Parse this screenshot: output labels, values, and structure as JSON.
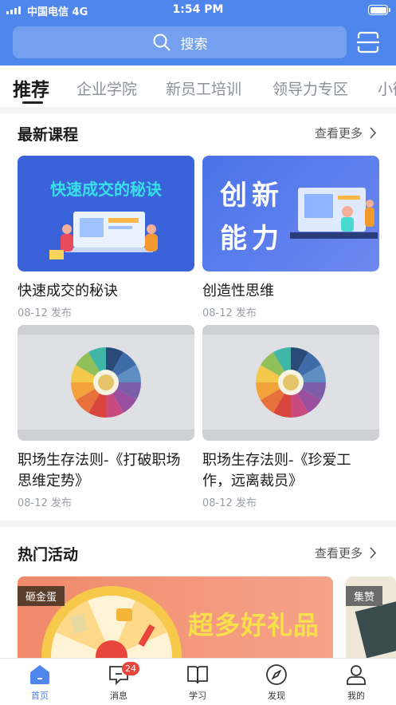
{
  "status_bar": {
    "carrier": "中国电信  4G",
    "time": "1:54 PM"
  },
  "search": {
    "placeholder": "搜索"
  },
  "tabs": [
    {
      "label": "推荐"
    },
    {
      "label": "企业学院"
    },
    {
      "label": "新员工培训"
    },
    {
      "label": "领导力专区"
    },
    {
      "label": "小微"
    }
  ],
  "latest": {
    "heading": "最新课程",
    "more": "查看更多",
    "courses": [
      {
        "title": "快速成交的秘诀",
        "date": "08-12 发布",
        "thumb_text": "快速成交的秘诀"
      },
      {
        "title": "创造性思维",
        "date": "08-12 发布",
        "thumb_text": "创 新 能 力"
      },
      {
        "title": "职场生存法则-《打破职场思维定势》",
        "date": "08-12 发布"
      },
      {
        "title": "职场生存法则-《珍爱工作，远离裁员》",
        "date": "08-12 发布"
      }
    ]
  },
  "activities": {
    "heading": "热门活动",
    "more": "查看更多",
    "items": [
      {
        "tag": "砸金蛋",
        "banner_text": "超多好礼品"
      },
      {
        "tag": "集赞"
      }
    ]
  },
  "bottom_nav": [
    {
      "label": "首页",
      "icon": "home-icon"
    },
    {
      "label": "消息",
      "icon": "message-icon",
      "badge": "24"
    },
    {
      "label": "学习",
      "icon": "book-icon"
    },
    {
      "label": "发现",
      "icon": "compass-icon"
    },
    {
      "label": "我的",
      "icon": "user-icon"
    }
  ],
  "colors": {
    "brand": "#4f86ec",
    "badge": "#e8453c"
  }
}
